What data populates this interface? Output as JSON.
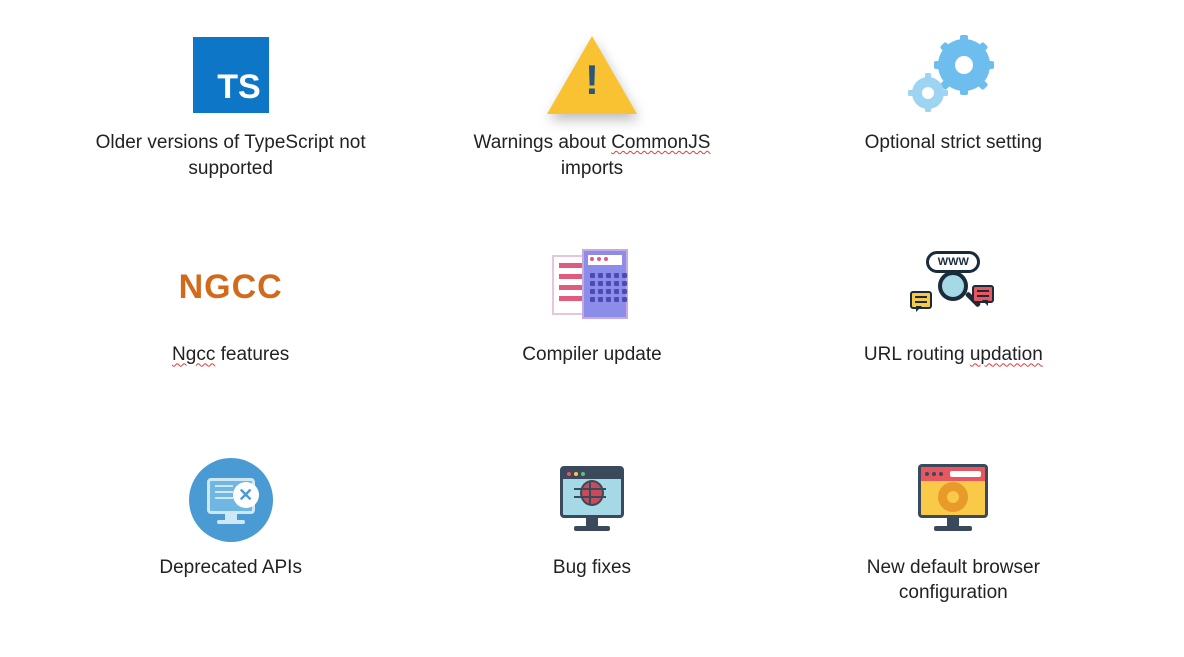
{
  "items": [
    {
      "icon": "typescript",
      "label_plain": "Older versions of TypeScript not supported"
    },
    {
      "icon": "warning",
      "label_html": "Warnings about <span class='spellcheck'>CommonJS</span> imports"
    },
    {
      "icon": "gears",
      "label_plain": "Optional strict setting"
    },
    {
      "icon": "ngcc",
      "label_html": "<span class='spellcheck'>Ngcc</span> features"
    },
    {
      "icon": "compiler",
      "label_plain": "Compiler update"
    },
    {
      "icon": "www",
      "label_html": "URL routing <span class='spellcheck'>updation</span>"
    },
    {
      "icon": "deprecated",
      "label_plain": "Deprecated APIs"
    },
    {
      "icon": "bug",
      "label_plain": "Bug fixes"
    },
    {
      "icon": "browser-config",
      "label_plain": "New default browser configuration"
    }
  ],
  "icon_text": {
    "typescript": "TS",
    "ngcc": "NGCC",
    "www_badge": "WWW"
  }
}
